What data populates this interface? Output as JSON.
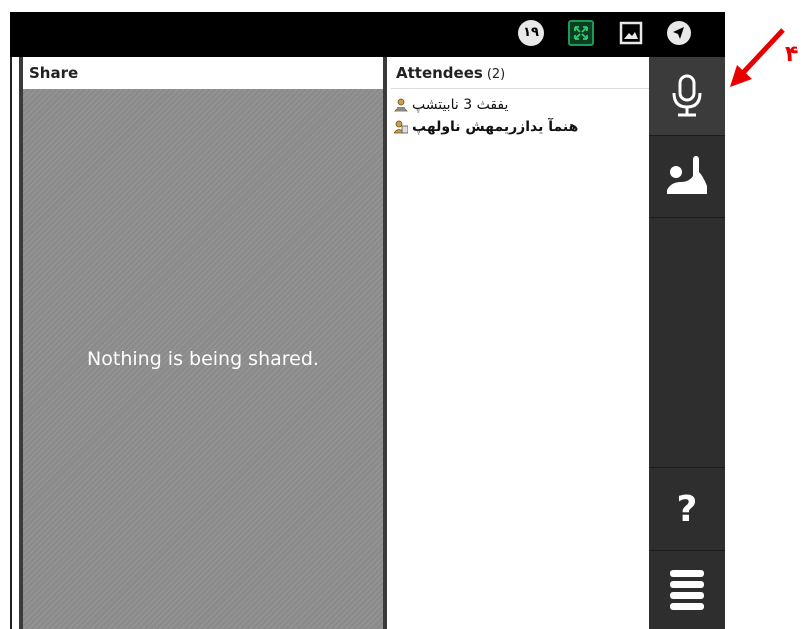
{
  "topbar": {
    "badge_number": "١٩",
    "icons": [
      "screen-share-icon",
      "image-icon",
      "navigation-icon"
    ]
  },
  "share": {
    "header": "Share",
    "empty_message": "Nothing is being shared."
  },
  "attendees": {
    "header": "Attendees",
    "count": "(2)",
    "list": [
      {
        "name": "یفقث 3 نابیتشپ"
      },
      {
        "name": "هنمآ یدازریمهش ناولهپ"
      }
    ]
  },
  "sidebar": {
    "buttons": [
      "microphone-icon",
      "raise-hand-icon",
      "help-icon",
      "menu-icon"
    ],
    "help_label": "?"
  },
  "annotation": {
    "number": "۴",
    "color": "#e60000"
  }
}
